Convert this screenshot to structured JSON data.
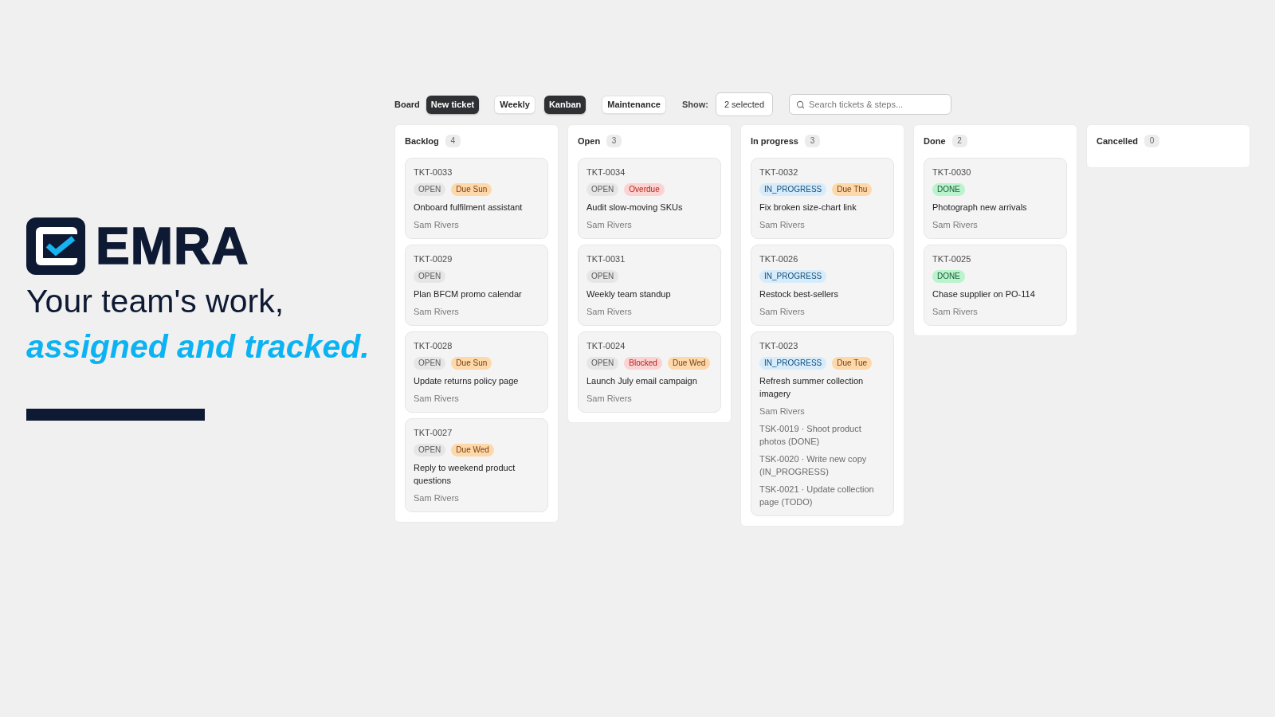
{
  "brand": {
    "name": "EMRA",
    "tagline": "Your team's work,",
    "tagline_highlight": "assigned and tracked."
  },
  "toolbar": {
    "title": "Board",
    "new_ticket_button": "New ticket",
    "views": [
      {
        "label": "Weekly",
        "selected": false
      },
      {
        "label": "Kanban",
        "selected": true
      },
      {
        "label": "Maintenance",
        "selected": false
      }
    ],
    "show_label": "Show:",
    "show_filter": "2 selected",
    "search": {
      "placeholder": "Search tickets & steps..."
    }
  },
  "columns": [
    {
      "title": "Backlog",
      "count": "4",
      "cards": [
        {
          "id": "TKT-0033",
          "badges": [
            {
              "kind": "open",
              "label": "OPEN"
            },
            {
              "kind": "due",
              "label": "Due Sun"
            }
          ],
          "title": "Onboard fulfilment assistant",
          "assignee": "Sam Rivers"
        },
        {
          "id": "TKT-0029",
          "badges": [
            {
              "kind": "open",
              "label": "OPEN"
            }
          ],
          "title": "Plan BFCM promo calendar",
          "assignee": "Sam Rivers"
        },
        {
          "id": "TKT-0028",
          "badges": [
            {
              "kind": "open",
              "label": "OPEN"
            },
            {
              "kind": "due",
              "label": "Due Sun"
            }
          ],
          "title": "Update returns policy page",
          "assignee": "Sam Rivers"
        },
        {
          "id": "TKT-0027",
          "badges": [
            {
              "kind": "open",
              "label": "OPEN"
            },
            {
              "kind": "due",
              "label": "Due Wed"
            }
          ],
          "title": "Reply to weekend product questions",
          "assignee": "Sam Rivers"
        }
      ]
    },
    {
      "title": "Open",
      "count": "3",
      "cards": [
        {
          "id": "TKT-0034",
          "badges": [
            {
              "kind": "open",
              "label": "OPEN"
            },
            {
              "kind": "alert",
              "label": "Overdue"
            }
          ],
          "title": "Audit slow-moving SKUs",
          "assignee": "Sam Rivers"
        },
        {
          "id": "TKT-0031",
          "badges": [
            {
              "kind": "open",
              "label": "OPEN"
            }
          ],
          "title": "Weekly team standup",
          "assignee": "Sam Rivers"
        },
        {
          "id": "TKT-0024",
          "badges": [
            {
              "kind": "open",
              "label": "OPEN"
            },
            {
              "kind": "alert",
              "label": "Blocked"
            },
            {
              "kind": "due",
              "label": "Due Wed"
            }
          ],
          "title": "Launch July email campaign",
          "assignee": "Sam Rivers"
        }
      ]
    },
    {
      "title": "In progress",
      "count": "3",
      "cards": [
        {
          "id": "TKT-0032",
          "badges": [
            {
              "kind": "in_progress",
              "label": "IN_PROGRESS"
            },
            {
              "kind": "due",
              "label": "Due Thu"
            }
          ],
          "title": "Fix broken size-chart link",
          "assignee": "Sam Rivers"
        },
        {
          "id": "TKT-0026",
          "badges": [
            {
              "kind": "in_progress",
              "label": "IN_PROGRESS"
            }
          ],
          "title": "Restock best-sellers",
          "assignee": "Sam Rivers"
        },
        {
          "id": "TKT-0023",
          "badges": [
            {
              "kind": "in_progress",
              "label": "IN_PROGRESS"
            },
            {
              "kind": "due",
              "label": "Due Tue"
            }
          ],
          "title": "Refresh summer collection imagery",
          "assignee": "Sam Rivers",
          "subtasks": [
            "TSK-0019 · Shoot product photos (DONE)",
            "TSK-0020 · Write new copy (IN_PROGRESS)",
            "TSK-0021 · Update collection page (TODO)"
          ]
        }
      ]
    },
    {
      "title": "Done",
      "count": "2",
      "cards": [
        {
          "id": "TKT-0030",
          "badges": [
            {
              "kind": "done",
              "label": "DONE"
            }
          ],
          "title": "Photograph new arrivals",
          "assignee": "Sam Rivers"
        },
        {
          "id": "TKT-0025",
          "badges": [
            {
              "kind": "done",
              "label": "DONE"
            }
          ],
          "title": "Chase supplier on PO-114",
          "assignee": "Sam Rivers"
        }
      ]
    },
    {
      "title": "Cancelled",
      "count": "0"
    }
  ]
}
